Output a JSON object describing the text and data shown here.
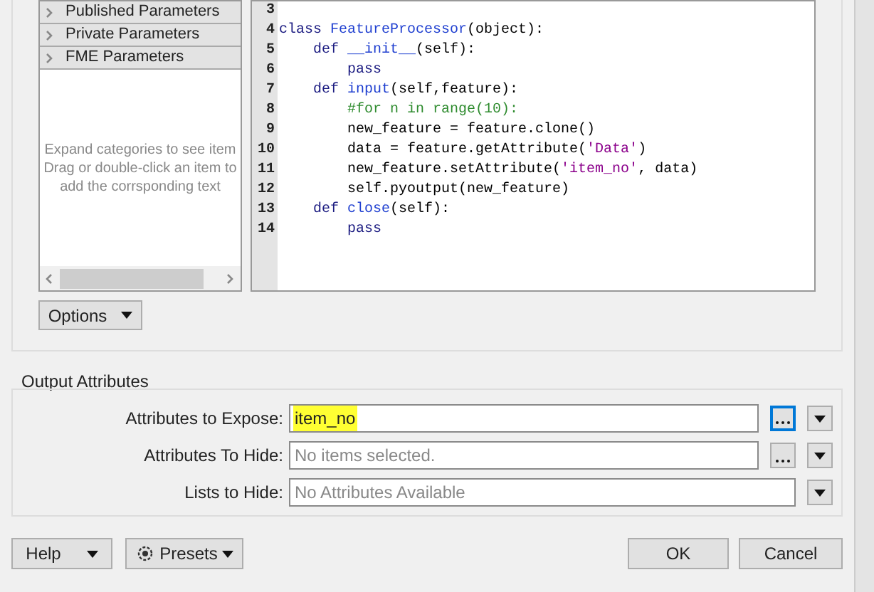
{
  "parameter_tree": {
    "categories": [
      {
        "label": "Published Parameters",
        "expanded": false
      },
      {
        "label": "Private Parameters",
        "expanded": false
      },
      {
        "label": "FME Parameters",
        "expanded": false
      }
    ],
    "hint": "Expand categories to see item Drag or double-click an item to add the corrsponding text"
  },
  "code_editor": {
    "lines": [
      {
        "number": "3"
      },
      {
        "number": "4",
        "tokens": [
          {
            "text": "class ",
            "kind": "keyword"
          },
          {
            "text": "FeatureProcessor",
            "kind": "name"
          },
          {
            "text": "(object):",
            "kind": "plain"
          }
        ]
      },
      {
        "number": "5",
        "tokens": [
          {
            "text": "    def ",
            "kind": "keyword"
          },
          {
            "text": "__init__",
            "kind": "name"
          },
          {
            "text": "(self):",
            "kind": "plain"
          }
        ]
      },
      {
        "number": "6",
        "tokens": [
          {
            "text": "        pass",
            "kind": "keyword"
          }
        ]
      },
      {
        "number": "7",
        "tokens": [
          {
            "text": "    def ",
            "kind": "keyword"
          },
          {
            "text": "input",
            "kind": "name"
          },
          {
            "text": "(self,feature):",
            "kind": "plain"
          }
        ]
      },
      {
        "number": "8",
        "tokens": [
          {
            "text": "        #for n in range(10):",
            "kind": "comment"
          }
        ]
      },
      {
        "number": "9",
        "tokens": [
          {
            "text": "        new_feature = feature.clone()",
            "kind": "plain"
          }
        ]
      },
      {
        "number": "10",
        "tokens": [
          {
            "text": "        data = feature.getAttribute(",
            "kind": "plain"
          },
          {
            "text": "'Data'",
            "kind": "string"
          },
          {
            "text": ")",
            "kind": "plain"
          }
        ]
      },
      {
        "number": "11",
        "tokens": [
          {
            "text": "        new_feature.setAttribute(",
            "kind": "plain"
          },
          {
            "text": "'item_no'",
            "kind": "string"
          },
          {
            "text": ", data)",
            "kind": "plain"
          }
        ]
      },
      {
        "number": "12",
        "tokens": [
          {
            "text": "        self.pyoutput(new_feature)",
            "kind": "plain"
          }
        ]
      },
      {
        "number": "13",
        "tokens": [
          {
            "text": "    def ",
            "kind": "keyword"
          },
          {
            "text": "close",
            "kind": "name"
          },
          {
            "text": "(self):",
            "kind": "plain"
          }
        ]
      },
      {
        "number": "14",
        "tokens": [
          {
            "text": "        pass",
            "kind": "keyword"
          }
        ]
      }
    ]
  },
  "options_button": {
    "label": "Options"
  },
  "output_attributes": {
    "title": "Output Attributes",
    "rows": [
      {
        "label": "Attributes to Expose:",
        "value": "item_no",
        "highlighted": true,
        "has_browse": true,
        "focused": true
      },
      {
        "label": "Attributes To Hide:",
        "placeholder": "No items selected.",
        "highlighted": false,
        "has_browse": true,
        "focused": false
      },
      {
        "label": "Lists to Hide:",
        "placeholder": "No Attributes Available",
        "highlighted": false,
        "has_browse": false,
        "focused": false
      }
    ]
  },
  "footer": {
    "help": "Help",
    "presets": "Presets",
    "ok": "OK",
    "cancel": "Cancel"
  }
}
